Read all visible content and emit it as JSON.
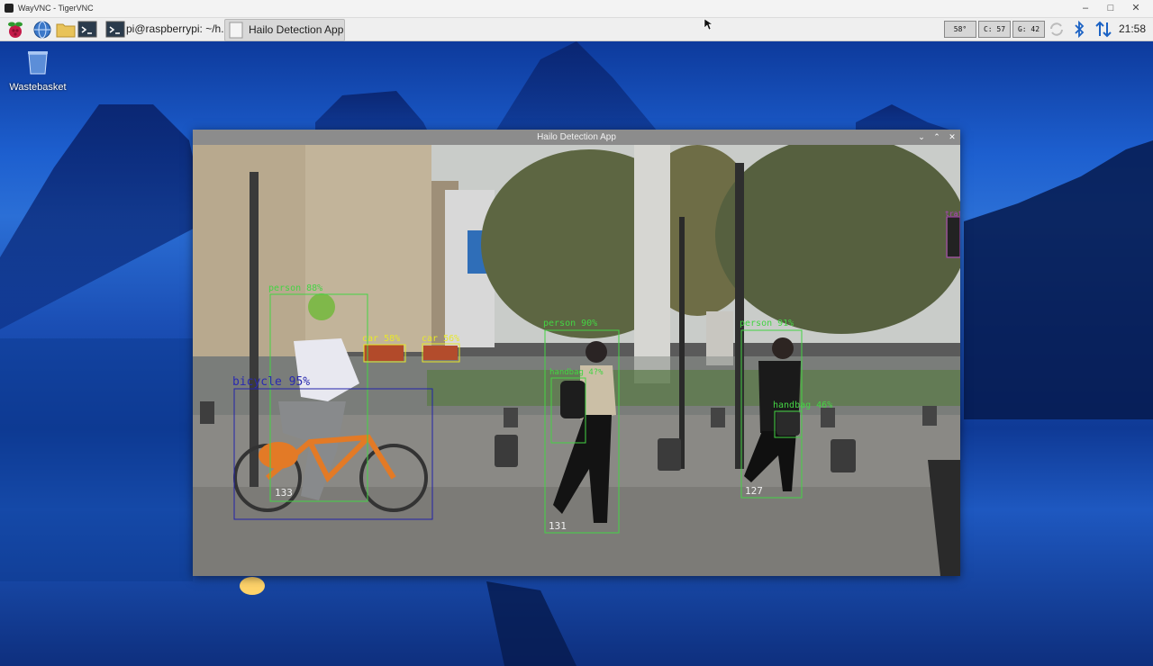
{
  "vnc_window": {
    "title": "WayVNC - TigerVNC",
    "minimize": "–",
    "maximize": "□",
    "close": "✕"
  },
  "taskbar": {
    "tasks": [
      {
        "label": "pi@raspberrypi: ~/h.."
      },
      {
        "label": "Hailo Detection App"
      }
    ],
    "monitors": {
      "temp": "58°",
      "cpu": "C: 57",
      "gpu": "G: 42"
    },
    "clock": "21:58"
  },
  "desktop": {
    "wastebasket_label": "Wastebasket"
  },
  "app_window": {
    "title": "Hailo Detection App",
    "controls": {
      "minimize": "⌄",
      "maximize": "⌃",
      "close": "✕"
    }
  },
  "detections": [
    {
      "label": "person 88%",
      "color": "#44d444",
      "track_id": "133"
    },
    {
      "label": "bicycle 95%",
      "color": "#2222aa"
    },
    {
      "label": "car 58%",
      "color": "#e8e828"
    },
    {
      "label": "car 56%",
      "color": "#e8e828"
    },
    {
      "label": "person 90%",
      "color": "#44d444",
      "track_id": "131"
    },
    {
      "label": "handbag 4?%",
      "color": "#44d444"
    },
    {
      "label": "person 91%",
      "color": "#44d444",
      "track_id": "127"
    },
    {
      "label": "handbag 46%",
      "color": "#44d444"
    },
    {
      "label": "traf",
      "color": "#b040c0"
    }
  ]
}
